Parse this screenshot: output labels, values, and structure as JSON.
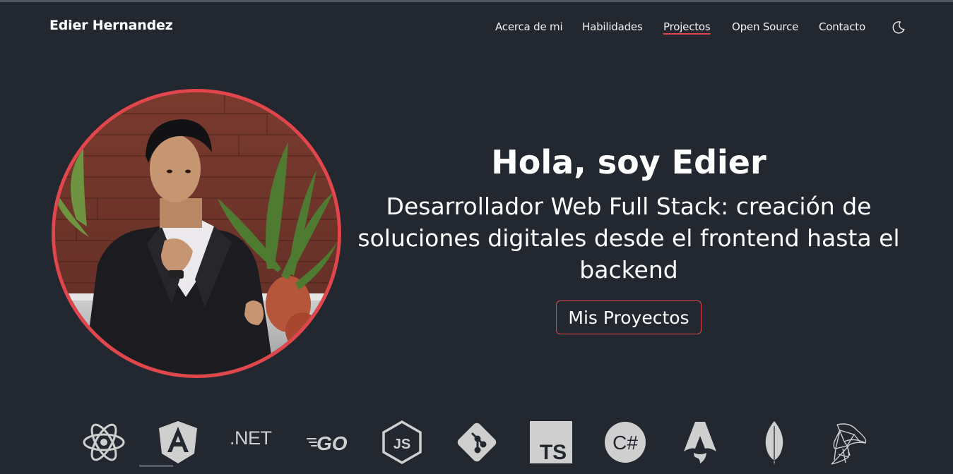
{
  "navbar": {
    "brand": "Edier Hernandez",
    "links": [
      {
        "label": "Acerca de mi",
        "active": false
      },
      {
        "label": "Habilidades",
        "active": false
      },
      {
        "label": "Projectos",
        "active": true
      },
      {
        "label": "Open Source",
        "active": false
      },
      {
        "label": "Contacto",
        "active": false
      }
    ],
    "theme_toggle_icon": "moon-icon"
  },
  "hero": {
    "title": "Hola, soy Edier",
    "subtitle_lines": [
      "Desarrollador Web Full Stack: creación de",
      "soluciones digitales desde el frontend hasta el",
      "backend"
    ],
    "button_label": "Mis Proyectos",
    "avatar_icon": "profile-photo"
  },
  "skills": {
    "icons": [
      "react-icon",
      "angular-icon",
      "dotnet-icon",
      "go-icon",
      "nodejs-icon",
      "git-icon",
      "typescript-icon",
      "csharp-icon",
      "astro-icon",
      "mongodb-icon",
      "sql-server-icon"
    ],
    "dotnet_text": ".NET",
    "go_text": "GO",
    "js_text": "JS",
    "ts_text": "TS",
    "csharp_text": "C#"
  },
  "colors": {
    "background": "#23272f",
    "accent": "#e0464c",
    "text": "#ffffff",
    "icon": "#cfcfcf"
  }
}
